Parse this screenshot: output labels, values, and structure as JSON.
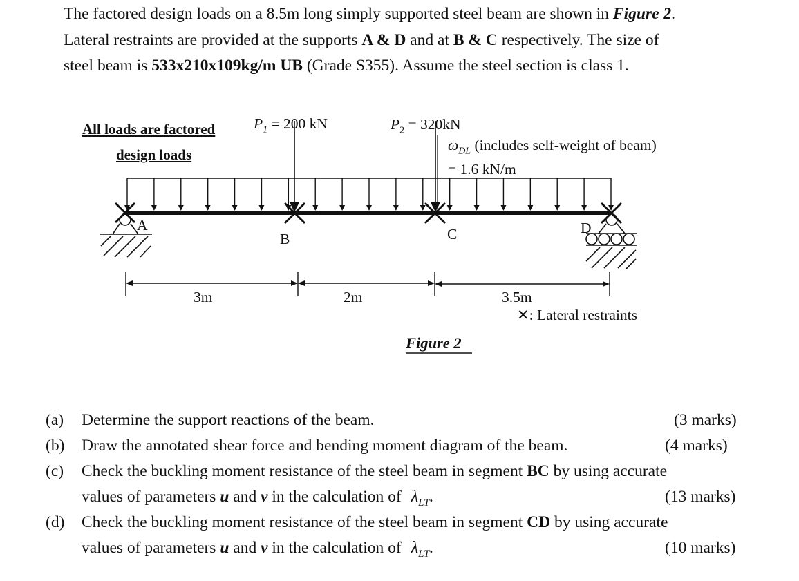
{
  "intro": {
    "s1": "The factored design loads on a 8.5m long simply supported steel beam are shown in ",
    "s1_fig": "Figure 2",
    "s1_end": ".",
    "s2a": "Lateral restraints are provided at the supports ",
    "s2_AD": "A & D",
    "s2b": " and at ",
    "s2_BC": "B & C",
    "s2c": " respectively. The size of",
    "s3a": "steel beam is ",
    "s3_section": "533x210x109kg/m UB",
    "s3b": " (Grade S355). Assume the steel section is class 1."
  },
  "figure": {
    "note_line1": "All loads are factored",
    "note_line2": "design loads",
    "p1_symbol": "P",
    "p1_sub": "1",
    "p1_value": " = 200 kN",
    "p2_symbol": "P",
    "p2_sub": "2",
    "p2_value": " = 320kN",
    "w_symbol": "ω",
    "w_sub": "DL",
    "w_desc": " (includes self-weight of beam)",
    "w_value": "= 1.6 kN/m",
    "points": [
      "A",
      "B",
      "C",
      "D"
    ],
    "spans": [
      "3m",
      "2m",
      "3.5m"
    ],
    "legend_symbol": "✕",
    "legend_text": ": Lateral restraints",
    "caption": "Figure 2"
  },
  "beam": {
    "length_m": 8.5,
    "point_loads_kN": [
      200,
      320
    ],
    "udl_kN_per_m": 1.6,
    "segments_m": [
      3,
      2,
      3.5
    ]
  },
  "questions": [
    {
      "tag": "(a)",
      "line1": "Determine the support reactions of the beam.",
      "marks": "(3 marks)"
    },
    {
      "tag": "(b)",
      "line1": "Draw the annotated shear force and bending moment diagram of the beam.",
      "marks": "(4 marks)"
    },
    {
      "tag": "(c)",
      "line1a": "Check the buckling moment resistance of the steel beam in segment ",
      "seg": "BC",
      "line1b": " by using accurate",
      "line2a": "values of parameters ",
      "u": "u",
      "and": " and ",
      "v": "v",
      "line2b": " in the calculation of",
      "lam": "λ",
      "lam_sub": "LT",
      "lam_end": ".",
      "marks": "(13 marks)"
    },
    {
      "tag": "(d)",
      "line1a": "Check the buckling moment resistance of the steel beam in segment ",
      "seg": "CD",
      "line1b": " by using accurate",
      "line2a": "values of parameters ",
      "u": "u",
      "and": " and ",
      "v": "v",
      "line2b": " in the calculation of",
      "lam": "λ",
      "lam_sub": "LT",
      "lam_end": ".",
      "marks": "(10 marks)"
    }
  ]
}
